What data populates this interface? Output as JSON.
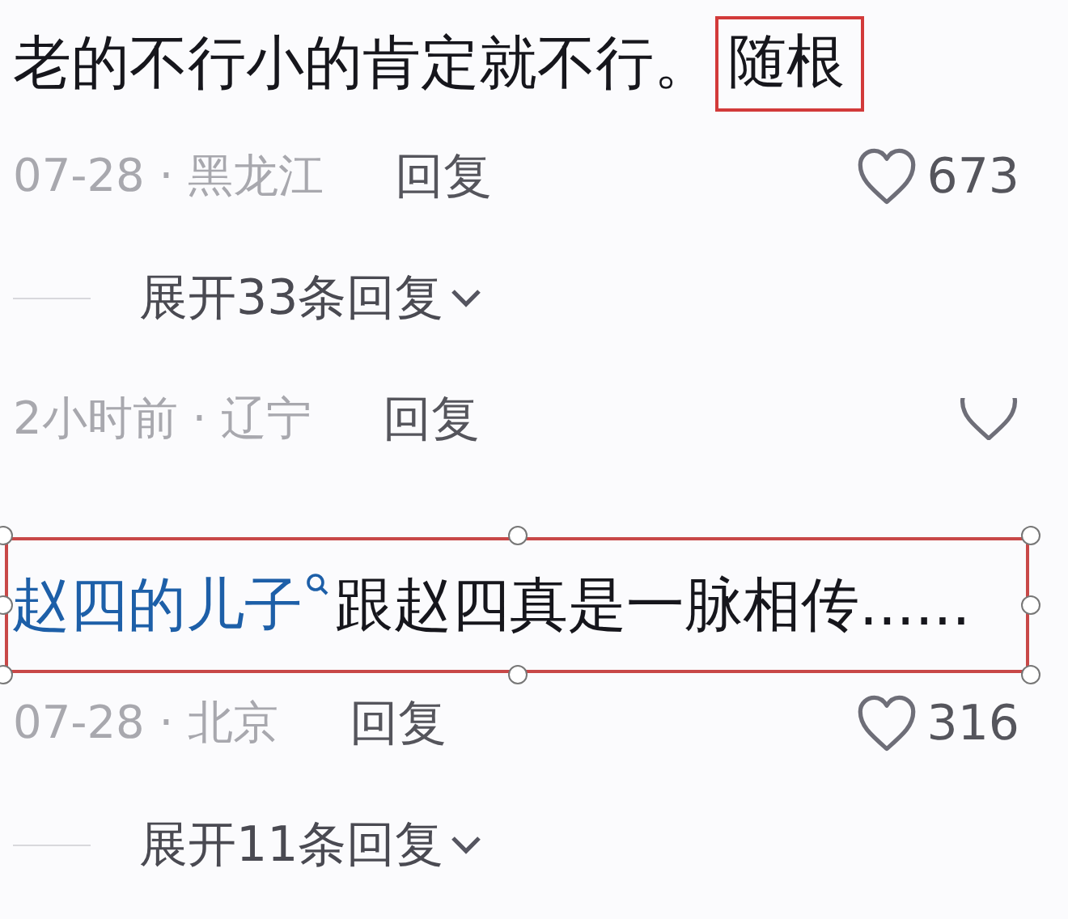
{
  "comments": [
    {
      "text_parts": [
        {
          "kind": "plain",
          "text": "老的不行小的肯定就不行。"
        },
        {
          "kind": "boxed",
          "text": "随根"
        }
      ],
      "meta": "07-28 · 黑龙江",
      "reply": "回复",
      "likes": "673",
      "expand": "展开33条回复"
    },
    {
      "meta": "2小时前 · 辽宁",
      "reply": "回复",
      "heart_cut": true
    },
    {
      "text_parts": [
        {
          "kind": "link",
          "text": "赵四的儿子"
        },
        {
          "kind": "plain",
          "text": "跟赵四真是一脉相传......"
        }
      ],
      "selected": true,
      "meta": "07-28 · 北京",
      "reply": "回复",
      "likes": "316",
      "expand": "展开11条回复"
    }
  ]
}
